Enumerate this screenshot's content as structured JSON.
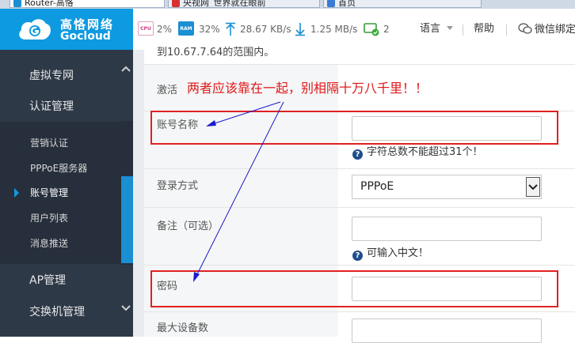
{
  "browser": {
    "tabs": [
      {
        "label": "Router-高恪",
        "icon_color": "#1a8fd4",
        "active": true
      },
      {
        "label": "央视网_世界就在眼前",
        "icon_color": "#d83030",
        "active": false
      },
      {
        "label": "首页",
        "icon_color": "#3a7bd5",
        "active": false
      }
    ]
  },
  "brand": {
    "name_cn": "高恪网络",
    "name_en": "Gocloud",
    "color": "#0e9ae0"
  },
  "header": {
    "cpu_chip": "CPU",
    "cpu": "2%",
    "ram_chip": "RAM",
    "ram": "32%",
    "upload": "28.67 KB/s",
    "download": "1.25 MB/s",
    "devices": "2",
    "language": "语言",
    "help": "帮助",
    "wechat": "微信绑定"
  },
  "sidebar": {
    "items": [
      {
        "label": "虚拟专网",
        "caret": "up"
      },
      {
        "label": "认证管理",
        "caret": "none"
      },
      {
        "label": "AP管理",
        "caret": "none"
      },
      {
        "label": "交换机管理",
        "caret": "down"
      }
    ],
    "submenu": [
      {
        "label": "营销认证",
        "active": false
      },
      {
        "label": "PPPoE服务器",
        "active": false
      },
      {
        "label": "账号管理",
        "active": true
      },
      {
        "label": "用户列表",
        "active": false
      },
      {
        "label": "消息推送",
        "active": false
      }
    ]
  },
  "content": {
    "partial_text": "到10.67.7.64的范围内。",
    "annotation": "两者应该靠在一起，别相隔十万八千里！！",
    "rows": {
      "activate": {
        "label": "激活"
      },
      "account_name": {
        "label": "账号名称",
        "value": "",
        "hint": "字符总数不能超过31个！"
      },
      "login_method": {
        "label": "登录方式",
        "selected": "PPPoE"
      },
      "remark": {
        "label": "备注（可选）",
        "value": "",
        "hint": "可输入中文！"
      },
      "password": {
        "label": "密码",
        "value": ""
      },
      "max_devices": {
        "label": "最大设备数"
      }
    }
  },
  "colors": {
    "accent": "#0e9ae0",
    "sidebar_bg": "#2e3948",
    "annotation": "#e01818",
    "arrow": "#1a1ad0"
  }
}
